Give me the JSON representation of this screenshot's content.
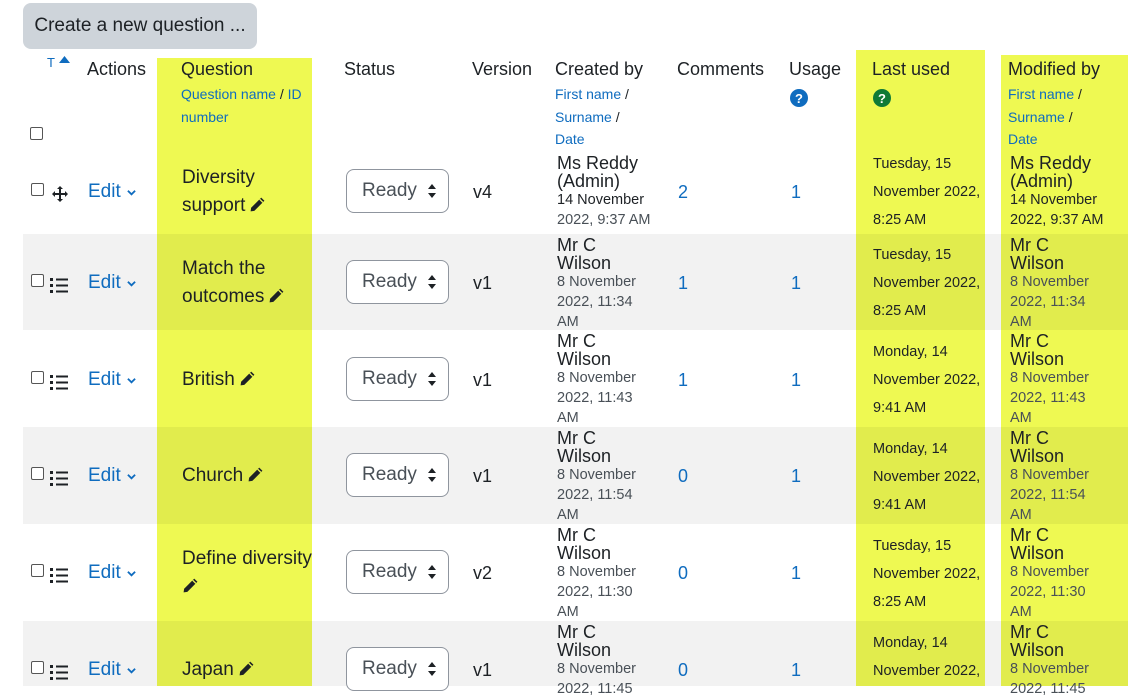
{
  "create_button": "Create a new question ...",
  "header": {
    "sort_indicator": "T",
    "actions": "Actions",
    "question": "Question",
    "question_sub1": "Question name",
    "question_sep": " / ",
    "question_sub2": "ID",
    "question_sub3": "number",
    "status": "Status",
    "version": "Version",
    "created_by": "Created by",
    "first_name": "First name",
    "surname": "Surname",
    "date": "Date",
    "sep": " /",
    "comments": "Comments",
    "usage": "Usage",
    "last_used": "Last used",
    "modified_by": "Modified by",
    "help_glyph": "?"
  },
  "edit_label": "Edit",
  "rows": [
    {
      "name_line1": "Diversity",
      "name_line2": "support",
      "status": "Ready",
      "version": "v4",
      "created_name1": "Ms Reddy",
      "created_name2": "(Admin)",
      "created_date1": "14 November",
      "created_date2": "2022, 9:37 AM",
      "comments": "2",
      "usage": "1",
      "last_used1": "Tuesday, 15",
      "last_used2": "November 2022,",
      "last_used3": "8:25 AM",
      "mod_name1": "Ms Reddy",
      "mod_name2": "(Admin)",
      "mod_date1": "14 November",
      "mod_date2": "2022, 9:37 AM"
    },
    {
      "name_line1": "Match the",
      "name_line2": "outcomes",
      "status": "Ready",
      "version": "v1",
      "created_name1": "Mr C",
      "created_name2": "Wilson",
      "created_date1": "8 November",
      "created_date2": "2022, 11:34",
      "created_date3": "AM",
      "comments": "1",
      "usage": "1",
      "last_used1": "Tuesday, 15",
      "last_used2": "November 2022,",
      "last_used3": "8:25 AM",
      "mod_name1": "Mr C",
      "mod_name2": "Wilson",
      "mod_date1": "8 November",
      "mod_date2": "2022, 11:34",
      "mod_date3": "AM"
    },
    {
      "name_line1": "British",
      "status": "Ready",
      "version": "v1",
      "created_name1": "Mr C",
      "created_name2": "Wilson",
      "created_date1": "8 November",
      "created_date2": "2022, 11:43",
      "created_date3": "AM",
      "comments": "1",
      "usage": "1",
      "last_used1": "Monday, 14",
      "last_used2": "November 2022,",
      "last_used3": "9:41 AM",
      "mod_name1": "Mr C",
      "mod_name2": "Wilson",
      "mod_date1": "8 November",
      "mod_date2": "2022, 11:43",
      "mod_date3": "AM"
    },
    {
      "name_line1": "Church",
      "status": "Ready",
      "version": "v1",
      "created_name1": "Mr C",
      "created_name2": "Wilson",
      "created_date1": "8 November",
      "created_date2": "2022, 11:54",
      "created_date3": "AM",
      "comments": "0",
      "usage": "1",
      "last_used1": "Monday, 14",
      "last_used2": "November 2022,",
      "last_used3": "9:41 AM",
      "mod_name1": "Mr C",
      "mod_name2": "Wilson",
      "mod_date1": "8 November",
      "mod_date2": "2022, 11:54",
      "mod_date3": "AM"
    },
    {
      "name_line1": "Define diversity",
      "status": "Ready",
      "version": "v2",
      "created_name1": "Mr C",
      "created_name2": "Wilson",
      "created_date1": "8 November",
      "created_date2": "2022, 11:30",
      "created_date3": "AM",
      "comments": "0",
      "usage": "1",
      "last_used1": "Tuesday, 15",
      "last_used2": "November 2022,",
      "last_used3": "8:25 AM",
      "mod_name1": "Mr C",
      "mod_name2": "Wilson",
      "mod_date1": "8 November",
      "mod_date2": "2022, 11:30",
      "mod_date3": "AM"
    },
    {
      "name_line1": "Japan",
      "status": "Ready",
      "version": "v1",
      "created_name1": "Mr C",
      "created_name2": "Wilson",
      "created_date1": "8 November",
      "created_date2": "2022, 11:45",
      "comments": "0",
      "usage": "1",
      "last_used1": "Monday, 14",
      "last_used2": "November 2022,",
      "mod_name1": "Mr C",
      "mod_name2": "Wilson",
      "mod_date1": "8 November",
      "mod_date2": "2022, 11:45"
    }
  ],
  "colors": {
    "highlight": "#eef952",
    "link": "#0f6cbf",
    "help_icon_blue": "#0f6cbf",
    "help_icon_green": "#0f7a36"
  }
}
